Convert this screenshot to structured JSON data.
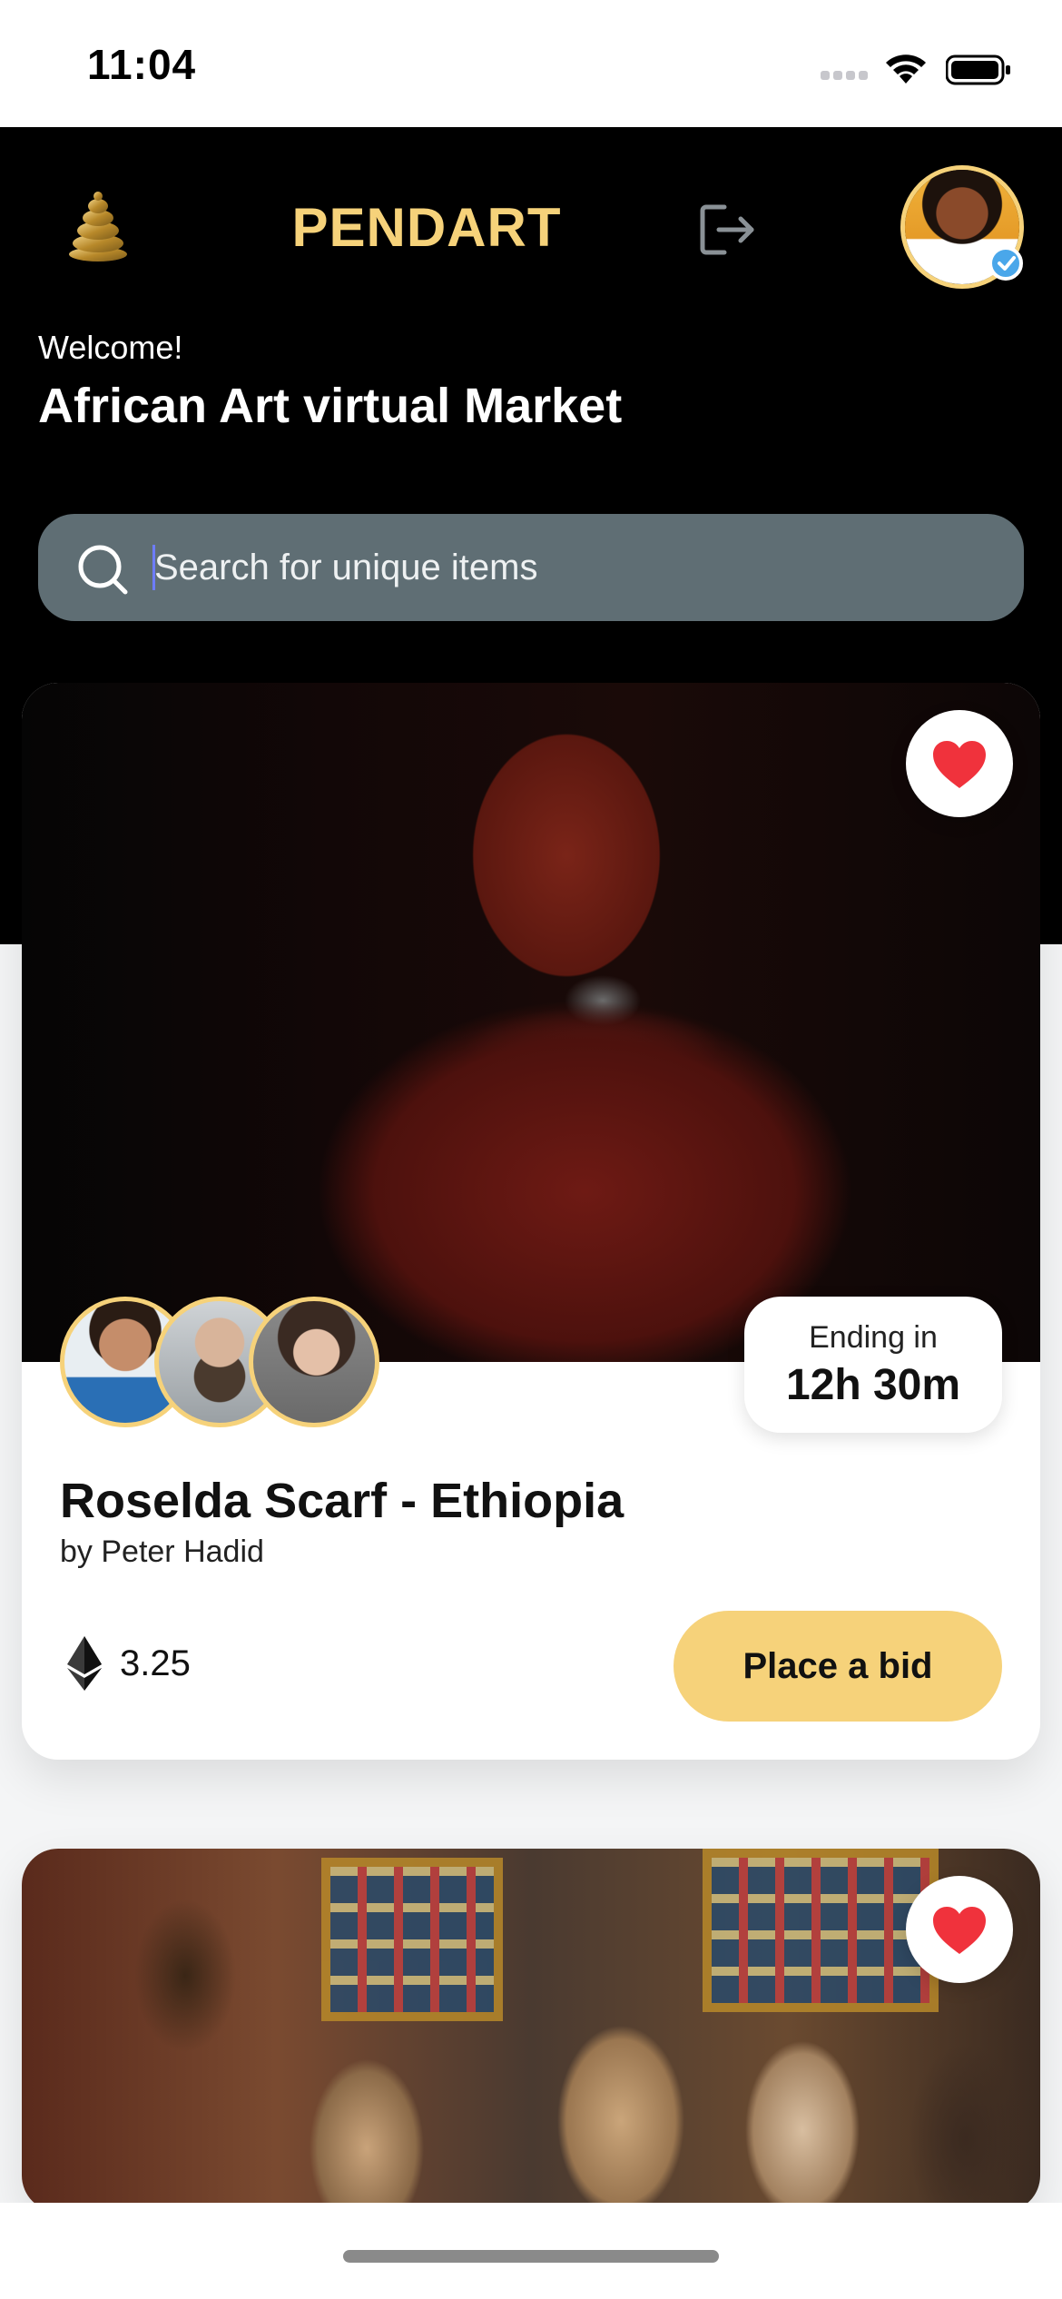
{
  "status_bar": {
    "time": "11:04"
  },
  "header": {
    "brand": "PENDART",
    "welcome": "Welcome!",
    "title": "African Art virtual Market"
  },
  "search": {
    "placeholder": "Search for unique items",
    "value": ""
  },
  "cards": [
    {
      "title": "Roselda Scarf - Ethiopia",
      "artist": "by Peter Hadid",
      "ending_label": "Ending in",
      "ending_time": "12h 30m",
      "price": "3.25",
      "bid_label": "Place a bid",
      "favorited": true
    },
    {
      "favorited": true
    }
  ],
  "colors": {
    "accent": "#f6d27a",
    "header_bg": "#000000",
    "search_bg": "#5f6e74",
    "heart": "#f0323c",
    "verified": "#4aa7ea"
  },
  "icons": {
    "logo": "hive-logo-icon",
    "logout": "logout-icon",
    "search": "search-icon",
    "favorite": "heart-icon",
    "currency": "ethereum-icon",
    "verified": "verified-check-icon"
  }
}
